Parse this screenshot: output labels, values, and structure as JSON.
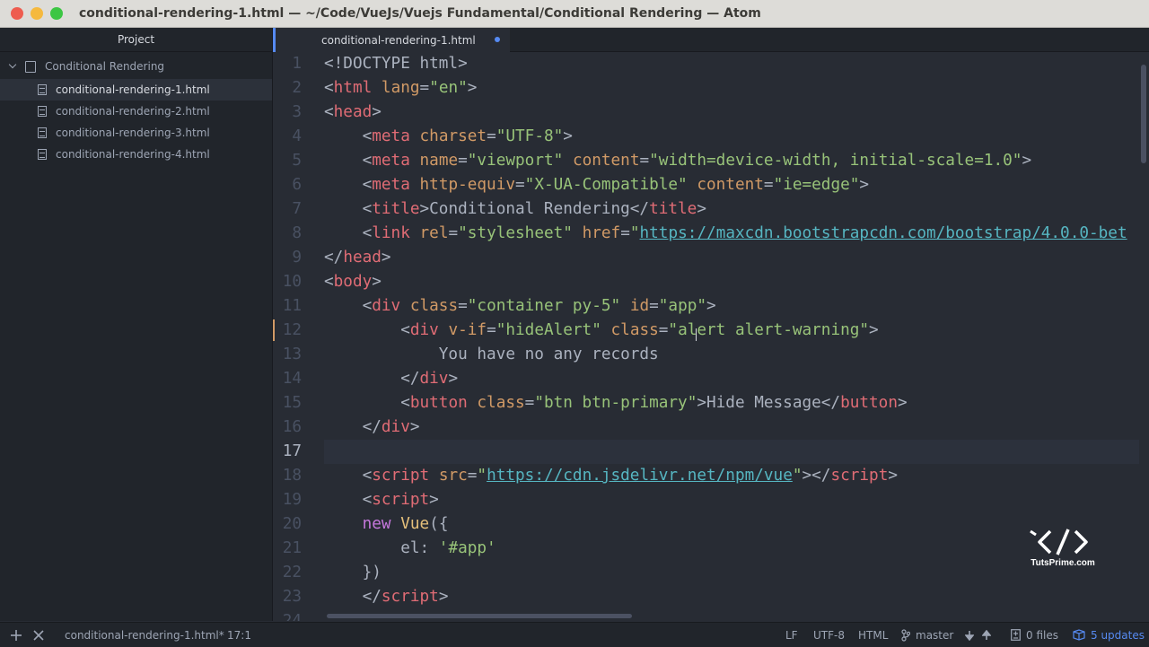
{
  "window": {
    "title": "conditional-rendering-1.html — ~/Code/VueJs/Vuejs Fundamental/Conditional Rendering — Atom",
    "traffic_light_colors": [
      "#ee5c4f",
      "#f5b93e",
      "#3cc643"
    ]
  },
  "sidebar": {
    "header": "Project",
    "root_folder": "Conditional Rendering",
    "files": [
      {
        "label": "conditional-rendering-1.html",
        "selected": true
      },
      {
        "label": "conditional-rendering-2.html",
        "selected": false
      },
      {
        "label": "conditional-rendering-3.html",
        "selected": false
      },
      {
        "label": "conditional-rendering-4.html",
        "selected": false
      }
    ]
  },
  "tab": {
    "label": "conditional-rendering-1.html",
    "modified": true
  },
  "editor": {
    "cursor_line": 17,
    "lines": [
      {
        "num": "1",
        "parts": [
          [
            "p",
            "<!DOCTYPE html>"
          ]
        ]
      },
      {
        "num": "2",
        "parts": [
          [
            "p",
            "<"
          ],
          [
            "t",
            "html"
          ],
          [
            "p",
            " "
          ],
          [
            "a",
            "lang"
          ],
          [
            "p",
            "="
          ],
          [
            "s",
            "\"en\""
          ],
          [
            "p",
            ">"
          ]
        ]
      },
      {
        "num": "3",
        "parts": [
          [
            "p",
            "<"
          ],
          [
            "t",
            "head"
          ],
          [
            "p",
            ">"
          ]
        ]
      },
      {
        "num": "4",
        "parts": [
          [
            "p",
            "    <"
          ],
          [
            "t",
            "meta"
          ],
          [
            "p",
            " "
          ],
          [
            "a",
            "charset"
          ],
          [
            "p",
            "="
          ],
          [
            "s",
            "\"UTF-8\""
          ],
          [
            "p",
            ">"
          ]
        ]
      },
      {
        "num": "5",
        "parts": [
          [
            "p",
            "    <"
          ],
          [
            "t",
            "meta"
          ],
          [
            "p",
            " "
          ],
          [
            "a",
            "name"
          ],
          [
            "p",
            "="
          ],
          [
            "s",
            "\"viewport\""
          ],
          [
            "p",
            " "
          ],
          [
            "a",
            "content"
          ],
          [
            "p",
            "="
          ],
          [
            "s",
            "\"width=device-width, initial-scale=1.0\""
          ],
          [
            "p",
            ">"
          ]
        ]
      },
      {
        "num": "6",
        "parts": [
          [
            "p",
            "    <"
          ],
          [
            "t",
            "meta"
          ],
          [
            "p",
            " "
          ],
          [
            "a",
            "http-equiv"
          ],
          [
            "p",
            "="
          ],
          [
            "s",
            "\"X-UA-Compatible\""
          ],
          [
            "p",
            " "
          ],
          [
            "a",
            "content"
          ],
          [
            "p",
            "="
          ],
          [
            "s",
            "\"ie=edge\""
          ],
          [
            "p",
            ">"
          ]
        ]
      },
      {
        "num": "7",
        "parts": [
          [
            "p",
            "    <"
          ],
          [
            "t",
            "title"
          ],
          [
            "p",
            ">Conditional Rendering</"
          ],
          [
            "t",
            "title"
          ],
          [
            "p",
            ">"
          ]
        ]
      },
      {
        "num": "8",
        "parts": [
          [
            "p",
            "    <"
          ],
          [
            "t",
            "link"
          ],
          [
            "p",
            " "
          ],
          [
            "a",
            "rel"
          ],
          [
            "p",
            "="
          ],
          [
            "s",
            "\"stylesheet\""
          ],
          [
            "p",
            " "
          ],
          [
            "a",
            "href"
          ],
          [
            "p",
            "="
          ],
          [
            "s",
            "\""
          ],
          [
            "u",
            "https://maxcdn.bootstrapcdn.com/bootstrap/4.0.0-bet"
          ]
        ]
      },
      {
        "num": "9",
        "parts": [
          [
            "p",
            "</"
          ],
          [
            "t",
            "head"
          ],
          [
            "p",
            ">"
          ]
        ]
      },
      {
        "num": "10",
        "parts": [
          [
            "p",
            "<"
          ],
          [
            "t",
            "body"
          ],
          [
            "p",
            ">"
          ]
        ]
      },
      {
        "num": "11",
        "parts": [
          [
            "p",
            "    <"
          ],
          [
            "t",
            "div"
          ],
          [
            "p",
            " "
          ],
          [
            "a",
            "class"
          ],
          [
            "p",
            "="
          ],
          [
            "s",
            "\"container py-5\""
          ],
          [
            "p",
            " "
          ],
          [
            "a",
            "id"
          ],
          [
            "p",
            "="
          ],
          [
            "s",
            "\"app\""
          ],
          [
            "p",
            ">"
          ]
        ]
      },
      {
        "num": "12",
        "parts": [
          [
            "p",
            "        <"
          ],
          [
            "t",
            "div"
          ],
          [
            "p",
            " "
          ],
          [
            "a",
            "v-if"
          ],
          [
            "p",
            "="
          ],
          [
            "s",
            "\"hideAlert\""
          ],
          [
            "p",
            " "
          ],
          [
            "a",
            "class"
          ],
          [
            "p",
            "="
          ],
          [
            "s",
            "\"alert alert-warning\""
          ],
          [
            "p",
            ">"
          ]
        ]
      },
      {
        "num": "13",
        "parts": [
          [
            "p",
            "            You have no any records"
          ]
        ]
      },
      {
        "num": "14",
        "parts": [
          [
            "p",
            "        </"
          ],
          [
            "t",
            "div"
          ],
          [
            "p",
            ">"
          ]
        ]
      },
      {
        "num": "15",
        "parts": [
          [
            "p",
            "        <"
          ],
          [
            "t",
            "button"
          ],
          [
            "p",
            " "
          ],
          [
            "a",
            "class"
          ],
          [
            "p",
            "="
          ],
          [
            "s",
            "\"btn btn-primary\""
          ],
          [
            "p",
            ">Hide Message</"
          ],
          [
            "t",
            "button"
          ],
          [
            "p",
            ">"
          ]
        ]
      },
      {
        "num": "16",
        "parts": [
          [
            "p",
            "    </"
          ],
          [
            "t",
            "div"
          ],
          [
            "p",
            ">"
          ]
        ]
      },
      {
        "num": "17",
        "parts": []
      },
      {
        "num": "18",
        "parts": [
          [
            "p",
            "    <"
          ],
          [
            "t",
            "script"
          ],
          [
            "p",
            " "
          ],
          [
            "a",
            "src"
          ],
          [
            "p",
            "="
          ],
          [
            "s",
            "\""
          ],
          [
            "u",
            "https://cdn.jsdelivr.net/npm/vue"
          ],
          [
            "s",
            "\""
          ],
          [
            "p",
            "></"
          ],
          [
            "t",
            "script"
          ],
          [
            "p",
            ">"
          ]
        ]
      },
      {
        "num": "19",
        "parts": [
          [
            "p",
            "    <"
          ],
          [
            "t",
            "script"
          ],
          [
            "p",
            ">"
          ]
        ]
      },
      {
        "num": "20",
        "parts": [
          [
            "p",
            "    "
          ],
          [
            "k",
            "new"
          ],
          [
            "p",
            " "
          ],
          [
            "f",
            "Vue"
          ],
          [
            "p",
            "({"
          ]
        ]
      },
      {
        "num": "21",
        "parts": [
          [
            "p",
            "        el: "
          ],
          [
            "s",
            "'#app'"
          ]
        ]
      },
      {
        "num": "22",
        "parts": [
          [
            "p",
            "    })"
          ]
        ]
      },
      {
        "num": "23",
        "parts": [
          [
            "p",
            "    </"
          ],
          [
            "t",
            "script"
          ],
          [
            "p",
            ">"
          ]
        ]
      },
      {
        "num": "24",
        "parts": []
      }
    ]
  },
  "watermark": {
    "symbol": "`</>",
    "text": "TutsPrime.com"
  },
  "status": {
    "file": "conditional-rendering-1.html*",
    "position": "17:1",
    "line_ending": "LF",
    "encoding": "UTF-8",
    "grammar": "HTML",
    "branch": "master",
    "files_changed": "0 files",
    "updates": "5 updates"
  },
  "colors": {
    "accent": "#568af2",
    "gutter_modified": "#d19a66"
  }
}
